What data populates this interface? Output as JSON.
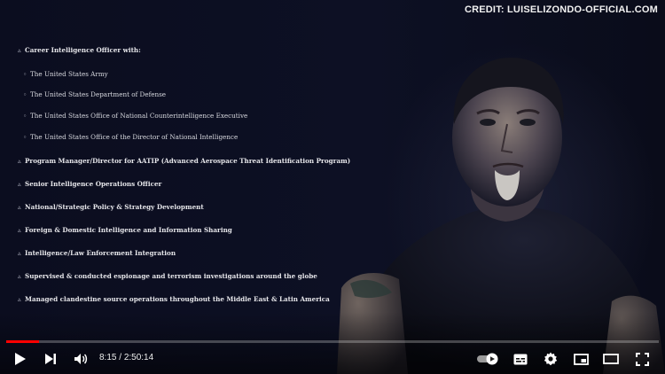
{
  "video": {
    "credit": "CREDIT: LUISELIZONDO-OFFICIAL.COM",
    "resume": {
      "bullet": "▵",
      "sub_bullet": "◦",
      "heading": "Career Intelligence Officer with:",
      "employers": [
        "The United States Army",
        "The United States Department of Defense",
        "The United States Office of National Counterintelligence Executive",
        "The United States Office of the Director of National Intelligence"
      ],
      "items": [
        "Program Manager/Director for AATIP (Advanced Aerospace Threat Identification Program)",
        "Senior Intelligence Operations Officer",
        "National/Strategic Policy & Strategy Development",
        "Foreign & Domestic Intelligence and Information Sharing",
        "Intelligence/Law Enforcement Integration",
        "Supervised & conducted espionage and terrorism investigations around the globe",
        "Managed clandestine source operations throughout the Middle East & Latin America"
      ]
    }
  },
  "player": {
    "current_time": "8:15",
    "separator": " / ",
    "duration": "2:50:14",
    "progress_fraction": 0.05,
    "accent_color": "#ff0000",
    "icons": [
      "play-icon",
      "next-icon",
      "volume-icon",
      "autoplay-toggle-icon",
      "subtitles-icon",
      "settings-icon",
      "miniplayer-icon",
      "theater-mode-icon",
      "fullscreen-icon"
    ]
  }
}
